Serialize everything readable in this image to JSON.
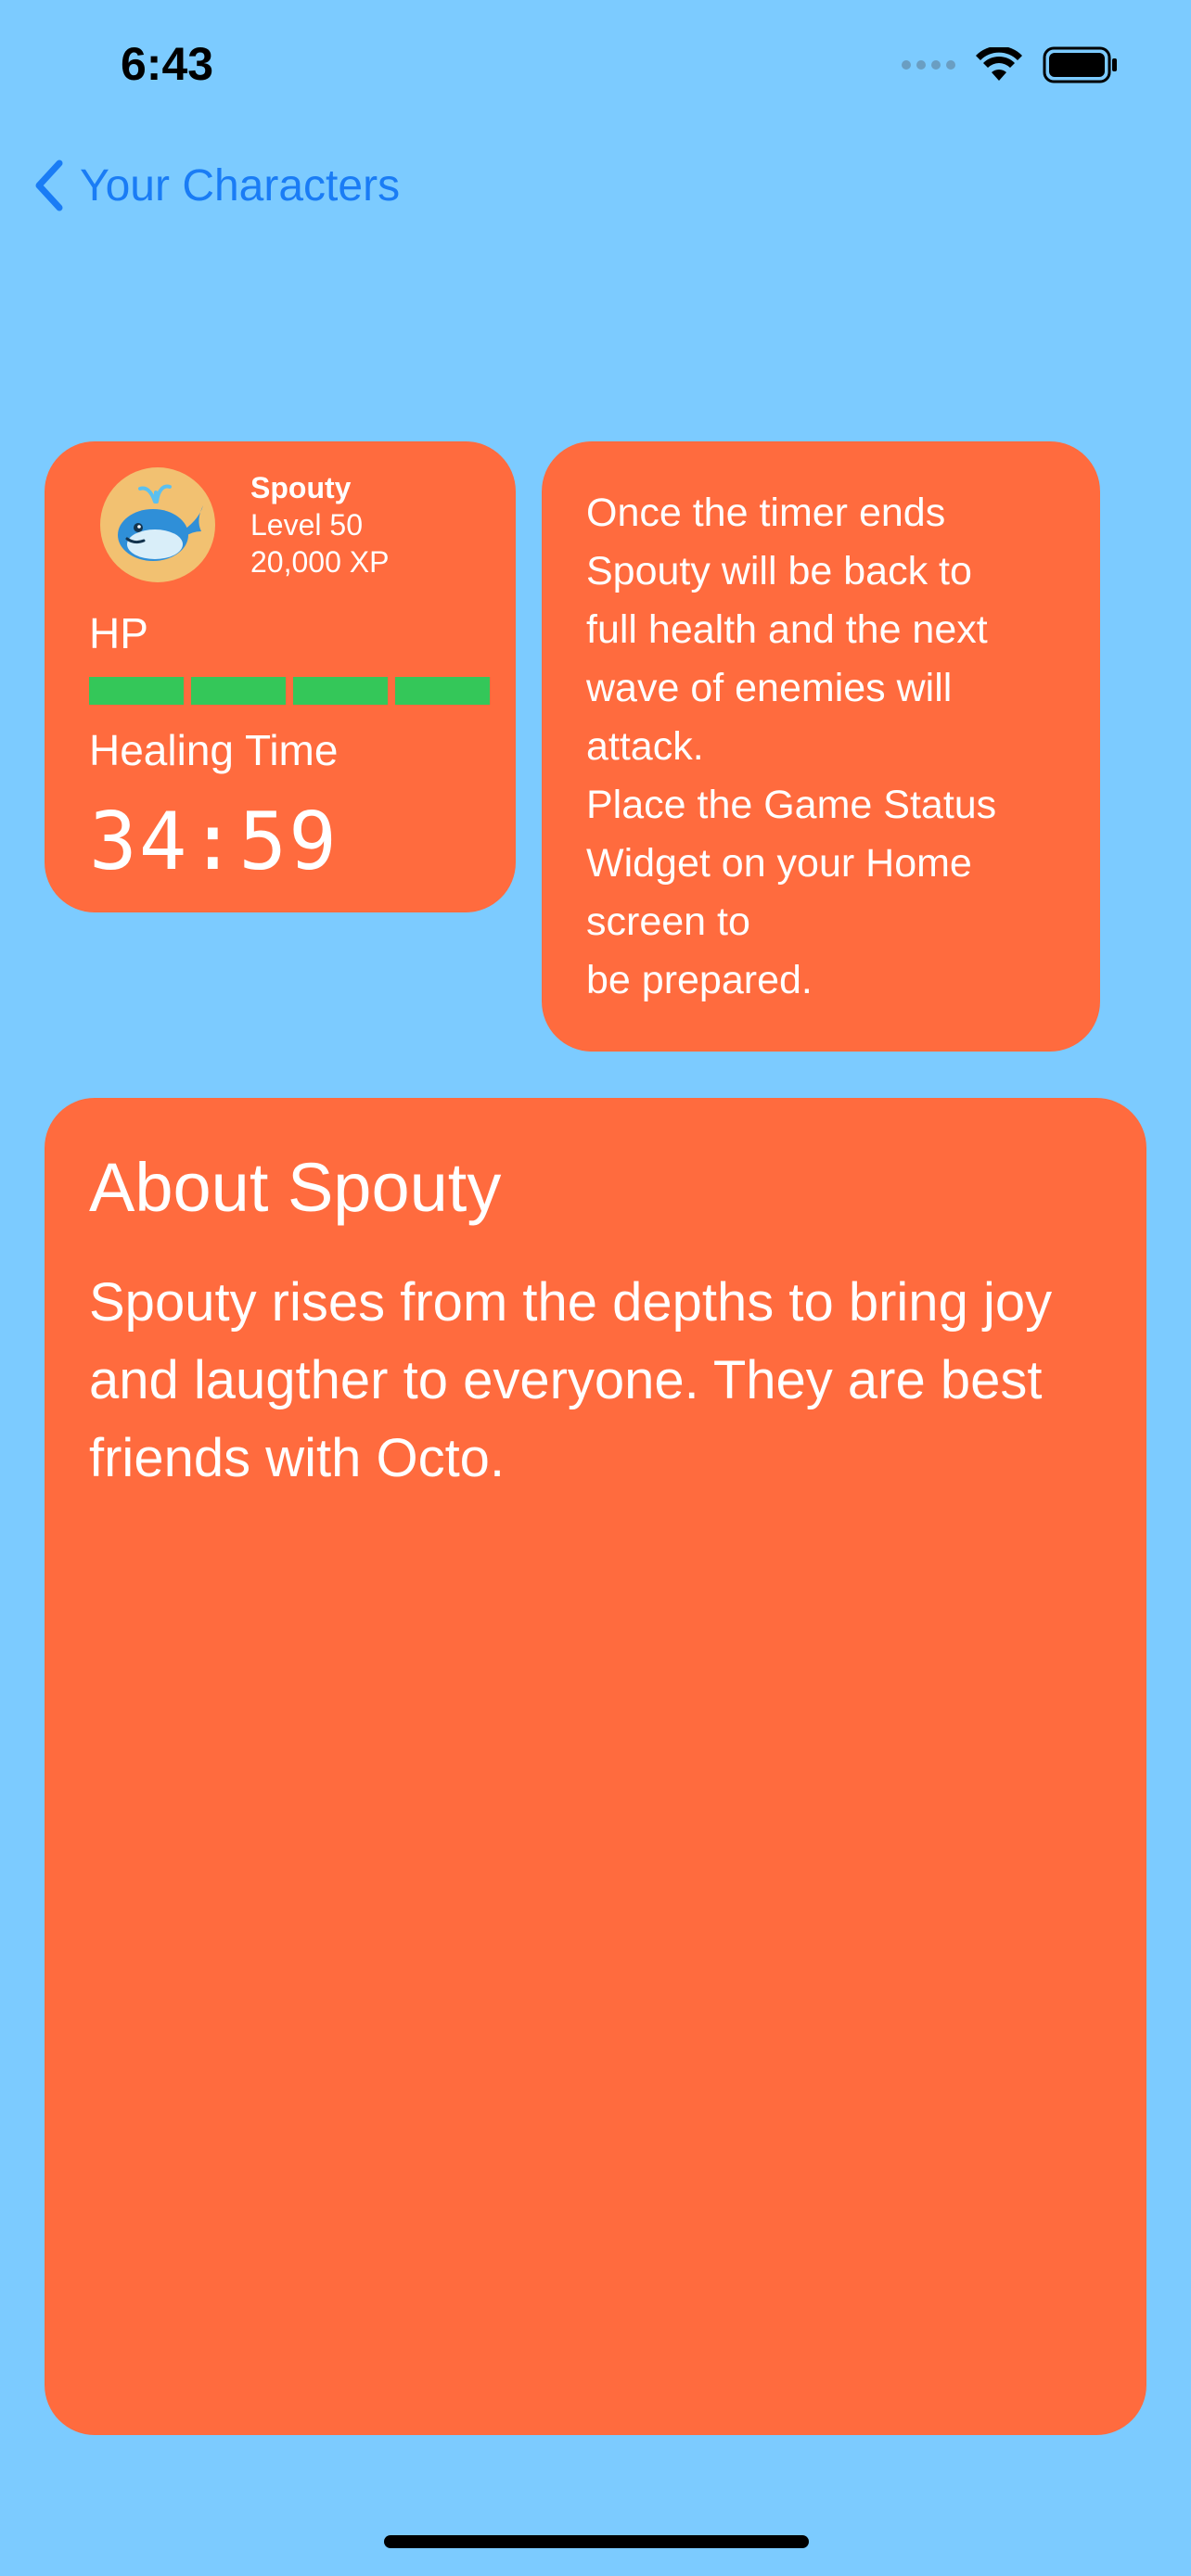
{
  "status_bar": {
    "time": "6:43"
  },
  "nav": {
    "back_label": "Your Characters"
  },
  "character": {
    "name": "Spouty",
    "level": "Level 50",
    "xp": "20,000 XP",
    "hp_label": "HP",
    "hp_segments_filled": 4,
    "hp_segments_total": 4,
    "healing_label": "Healing Time",
    "timer": "34:59",
    "hp_color": "#34c759"
  },
  "info": {
    "text": "Once the timer ends\nSpouty will be back to\nfull health and the next\nwave of enemies will\nattack.\nPlace the Game Status\nWidget on your Home\nscreen to\nbe prepared."
  },
  "about": {
    "title": "About Spouty",
    "text": "Spouty rises from the depths to bring joy and laugther to everyone. They are best friends with Octo."
  },
  "colors": {
    "background": "#7ccbff",
    "card": "#ff6b3e",
    "accent": "#1a7cf5"
  },
  "icons": {
    "back": "chevron-left-icon",
    "avatar": "whale-icon"
  }
}
